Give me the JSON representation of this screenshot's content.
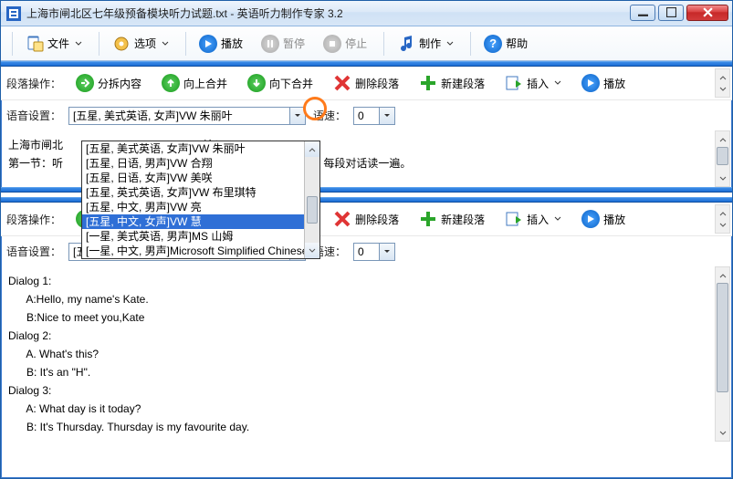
{
  "window": {
    "title": "上海市闸北区七年级预备模块听力试题.txt - 英语听力制作专家 3.2"
  },
  "menu": {
    "file": "文件",
    "options": "选项",
    "play": "播放",
    "pause": "暂停",
    "stop": "停止",
    "make": "制作",
    "help": "帮助"
  },
  "ops": {
    "label": "段落操作：",
    "split": "分拆内容",
    "mergeUp": "向上合并",
    "mergeDown": "向下合并",
    "delete": "删除段落",
    "new": "新建段落",
    "insert": "插入",
    "play": "播放"
  },
  "voice": {
    "label": "语音设置：",
    "selected": "[五星, 美式英语, 女声]VW 朱丽叶",
    "speedLabel": "语速：",
    "speed": "0",
    "options": [
      "[五星, 美式英语, 女声]VW 朱丽叶",
      "[五星, 日语, 男声]VW 合翔",
      "[五星, 日语, 女声]VW 美咲",
      "[五星, 英式英语, 女声]VW 布里琪特",
      "[五星, 中文, 男声]VW 亮",
      "[五星, 中文, 女声]VW 慧",
      "[一星, 美式英语, 男声]MS 山姆",
      "[一星, 中文, 男声]Microsoft Simplified Chinese"
    ],
    "selectedIndex": 5
  },
  "contentTop": "上海市闸北                                              始！\n第一节：听                                              择符合对话内容的图片。每段对话读一遍。",
  "contentBottom": "Dialog 1:\n      A:Hello, my name's Kate.\n      B:Nice to meet you,Kate\nDialog 2:\n      A. What's this?\n      B: It's an \"H\".\nDialog 3:\n      A: What day is it today?\n      B: It's Thursday. Thursday is my favourite day."
}
